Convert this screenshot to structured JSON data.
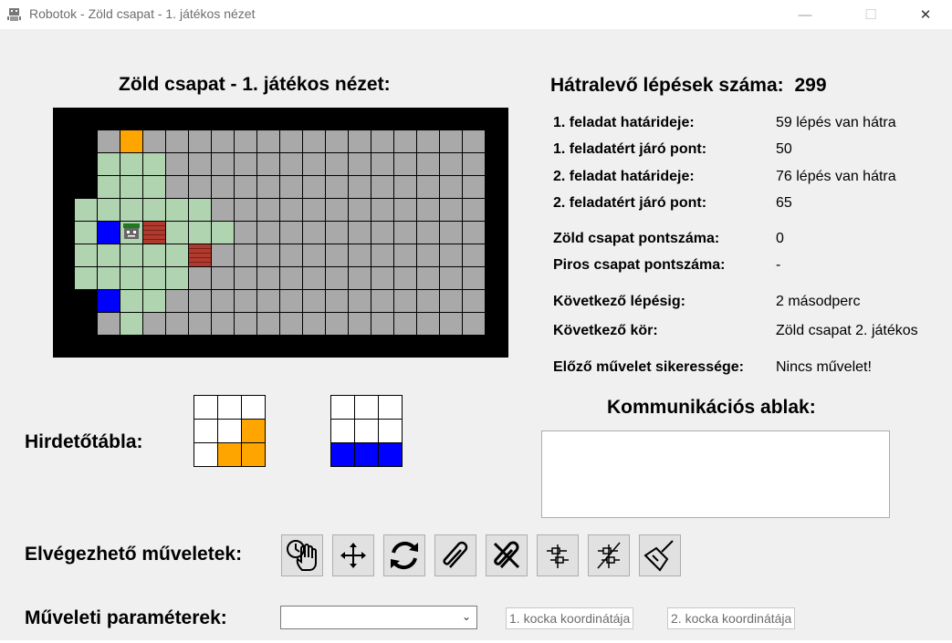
{
  "window": {
    "title": "Robotok - Zöld csapat - 1. játékos nézet",
    "minimize": "—",
    "maximize": "☐",
    "close": "✕"
  },
  "board": {
    "title": "Zöld csapat - 1. játékos nézet:",
    "colors": {
      "wall": "#000000",
      "unknown": "#a9a9a9",
      "visible": "#b0d4b0",
      "orange": "#ffa500",
      "blue": "#0000ff",
      "brick": "#b03a2e",
      "robot": "#2a8a2a"
    },
    "cols": 18,
    "rows": 10,
    "grid": [
      "WWWWWWWWWWWWWWWWWWWW",
      "WWUOUUUUUUUUUUUUUUUW",
      "WWVVVUUUUUUUUUUUUUUW",
      "WWVVVUUUUUUUUUUUUUUW",
      "WVVVVVVUUUUUUUUUUUUW",
      "WVBRXVVVUUUUUUUUUUUW",
      "WVVVVVXUUUUUUUUUUUUW",
      "WVVVVVUUUUUUUUUUUUUW",
      "WWBVVUUUUUUUUUUUUUUW",
      "WWUVUUUUUUUUUUUUUUUW",
      "WWWWWWWWWWWWWWWWWWWW"
    ]
  },
  "info": {
    "remaining_label": "Hátralevő lépések száma:",
    "remaining_value": "299",
    "rows": [
      {
        "label": "1. feladat határideje:",
        "value": "59 lépés van hátra"
      },
      {
        "label": "1. feladatért járó pont:",
        "value": "50"
      },
      {
        "label": "2. feladat határideje:",
        "value": "76 lépés van hátra"
      },
      {
        "label": "2. feladatért járó pont:",
        "value": "65"
      },
      {
        "label": "Zöld csapat pontszáma:",
        "value": "0"
      },
      {
        "label": "Piros csapat pontszáma:",
        "value": "-"
      },
      {
        "label": "Következő lépésig:",
        "value": "2 másodperc"
      },
      {
        "label": "Következő kör:",
        "value": "Zöld csapat 2. játékos"
      },
      {
        "label": "Előző művelet sikeressége:",
        "value": "Nincs művelet!"
      }
    ]
  },
  "billboard": {
    "label": "Hirdetőtábla:",
    "grids": [
      [
        "W",
        "W",
        "W",
        "W",
        "W",
        "O",
        "W",
        "O",
        "O"
      ],
      [
        "W",
        "W",
        "W",
        "W",
        "W",
        "W",
        "B",
        "B",
        "B"
      ]
    ]
  },
  "comm": {
    "title": "Kommunikációs ablak:",
    "text": ""
  },
  "actions": {
    "label": "Elvégezhető műveletek:",
    "buttons": [
      "wait-icon",
      "move-icon",
      "rotate-icon",
      "attach-icon",
      "detach-icon",
      "connect-cubes-icon",
      "disconnect-cubes-icon",
      "clean-icon"
    ]
  },
  "params": {
    "label": "Műveleti paraméterek:",
    "select_value": "",
    "coord1_placeholder": "1. kocka koordinátája",
    "coord2_placeholder": "2. kocka koordinátája"
  }
}
